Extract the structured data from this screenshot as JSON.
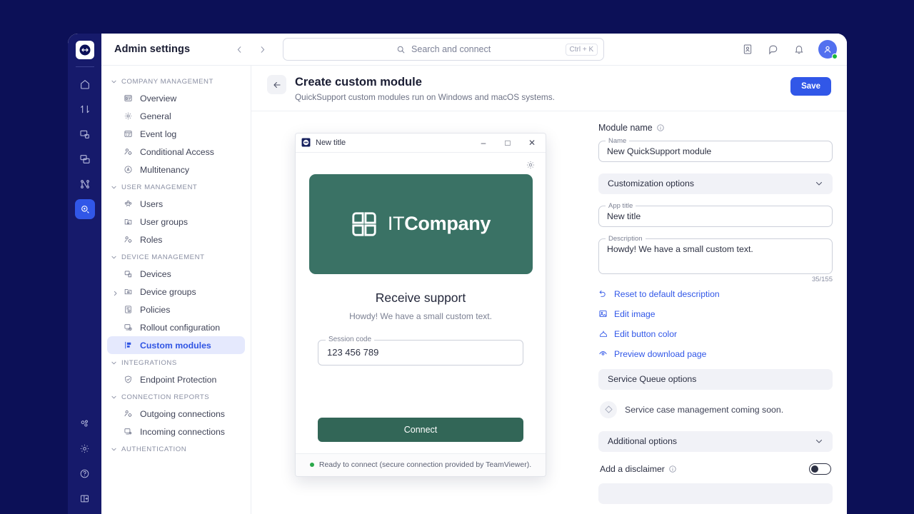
{
  "window": {
    "topbar": {
      "title": "Admin settings",
      "back_icon": "chevron-left-icon",
      "forward_icon": "chevron-right-icon",
      "search": {
        "placeholder": "Search and connect",
        "shortcut": "Ctrl + K",
        "icon": "search-icon"
      },
      "icons": [
        "contacts-icon",
        "chat-icon",
        "bell-icon"
      ],
      "avatar": {
        "icon": "user-avatar-icon",
        "status": "online"
      }
    },
    "rail": {
      "logo": "teamviewer-logo-icon",
      "items": [
        {
          "icon": "home-icon",
          "active": false
        },
        {
          "icon": "transfer-icon",
          "active": false
        },
        {
          "icon": "remote-device-icon",
          "active": false
        },
        {
          "icon": "devices-group-icon",
          "active": false
        },
        {
          "icon": "flowchart-icon",
          "active": false
        },
        {
          "icon": "admin-settings-icon",
          "active": true
        }
      ],
      "bottom_items": [
        {
          "icon": "apps-icon"
        },
        {
          "icon": "gear-icon"
        },
        {
          "icon": "help-icon"
        },
        {
          "icon": "logout-icon"
        }
      ]
    }
  },
  "sidebar": {
    "groups": [
      {
        "label": "COMPANY MANAGEMENT",
        "items": [
          {
            "label": "Overview",
            "icon": "overview-icon",
            "active": false,
            "expandable": false
          },
          {
            "label": "General",
            "icon": "gear-icon",
            "active": false,
            "expandable": false
          },
          {
            "label": "Event log",
            "icon": "event-log-icon",
            "active": false,
            "expandable": false
          },
          {
            "label": "Conditional Access",
            "icon": "conditional-access-icon",
            "active": false,
            "expandable": false
          },
          {
            "label": "Multitenancy",
            "icon": "multitenancy-icon",
            "active": false,
            "expandable": false
          }
        ]
      },
      {
        "label": "USER MANAGEMENT",
        "items": [
          {
            "label": "Users",
            "icon": "users-icon",
            "active": false,
            "expandable": false
          },
          {
            "label": "User groups",
            "icon": "user-groups-icon",
            "active": false,
            "expandable": false
          },
          {
            "label": "Roles",
            "icon": "roles-icon",
            "active": false,
            "expandable": false
          }
        ]
      },
      {
        "label": "DEVICE MANAGEMENT",
        "items": [
          {
            "label": "Devices",
            "icon": "device-icon",
            "active": false,
            "expandable": false
          },
          {
            "label": "Device groups",
            "icon": "device-groups-icon",
            "active": false,
            "expandable": true
          },
          {
            "label": "Policies",
            "icon": "policies-icon",
            "active": false,
            "expandable": false
          },
          {
            "label": "Rollout configuration",
            "icon": "rollout-icon",
            "active": false,
            "expandable": false
          },
          {
            "label": "Custom modules",
            "icon": "custom-modules-icon",
            "active": true,
            "expandable": false
          }
        ]
      },
      {
        "label": "INTEGRATIONS",
        "items": [
          {
            "label": "Endpoint Protection",
            "icon": "shield-icon",
            "active": false,
            "expandable": false
          }
        ]
      },
      {
        "label": "CONNECTION REPORTS",
        "items": [
          {
            "label": "Outgoing connections",
            "icon": "outgoing-connections-icon",
            "active": false,
            "expandable": false
          },
          {
            "label": "Incoming connections",
            "icon": "incoming-connections-icon",
            "active": false,
            "expandable": false
          }
        ]
      },
      {
        "label": "AUTHENTICATION",
        "items": []
      }
    ]
  },
  "page": {
    "back_icon": "arrow-left-icon",
    "title": "Create custom module",
    "subtitle": "QuickSupport custom modules run on Windows and macOS systems.",
    "save_label": "Save"
  },
  "preview": {
    "titlebar": {
      "app_icon": "teamviewer-logo-icon",
      "title": "New title",
      "minimize": "–",
      "maximize": "□",
      "close": "✕"
    },
    "gear_icon": "gear-icon",
    "banner": {
      "logo_icon": "itcompany-logo-icon",
      "logo_text_light": "IT",
      "logo_text_bold": "Company",
      "background_color": "#3a7265"
    },
    "heading": "Receive support",
    "subheading": "Howdy! We have a small custom text.",
    "session_field": {
      "label": "Session code",
      "value": "123 456 789"
    },
    "connect_label": "Connect",
    "status": {
      "text": "Ready to connect (secure connection provided by TeamViewer).",
      "dot_color": "#2aa84a"
    }
  },
  "settings": {
    "module_name_label": "Module name",
    "module_name_info_icon": "info-icon",
    "name_field": {
      "label": "Name",
      "value": "New QuickSupport module"
    },
    "customization_section": {
      "label": "Customization options",
      "chevron": "chevron-down-icon"
    },
    "app_title_field": {
      "label": "App title",
      "value": "New title"
    },
    "description_field": {
      "label": "Description",
      "value": "Howdy! We have a small custom text."
    },
    "description_counter": "35/155",
    "links": [
      {
        "label": "Reset to default description",
        "icon": "undo-icon"
      },
      {
        "label": "Edit image",
        "icon": "image-icon"
      },
      {
        "label": "Edit button color",
        "icon": "color-icon"
      },
      {
        "label": "Preview download page",
        "icon": "eye-icon"
      }
    ],
    "service_queue_section": {
      "label": "Service Queue options"
    },
    "service_queue_note": {
      "text": "Service case management coming soon.",
      "icon": "diamond-icon"
    },
    "additional_section": {
      "label": "Additional options",
      "chevron": "chevron-down-icon"
    },
    "disclaimer": {
      "label": "Add a disclaimer",
      "info_icon": "info-icon",
      "enabled": false
    }
  },
  "colors": {
    "desktop_bg": "#0c1057",
    "rail_bg": "#161a6b",
    "accent_blue": "#3157e8",
    "accent_blue_soft": "#e5e9fd",
    "brand_green": "#3a7265",
    "status_green": "#2aa84a"
  }
}
